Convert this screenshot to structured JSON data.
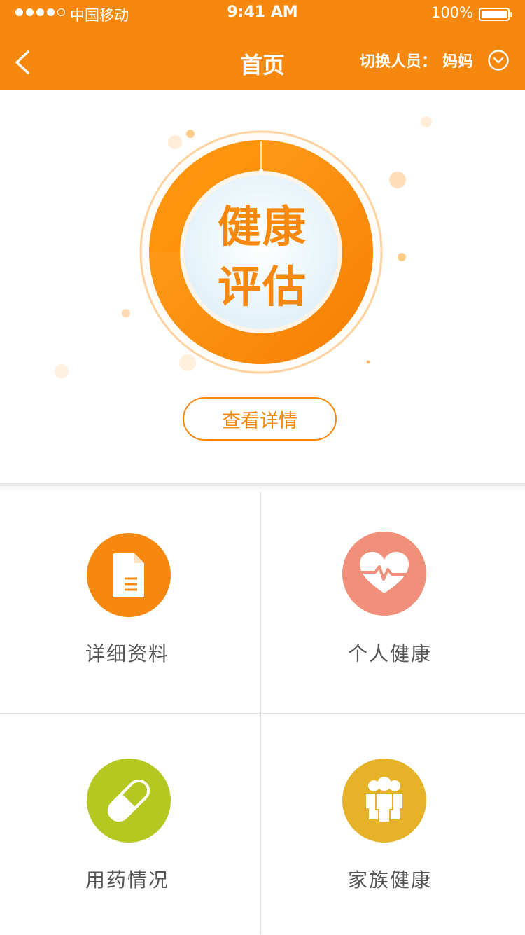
{
  "status_bar": {
    "carrier": "中国移动",
    "time": "9:41 AM",
    "battery": "100%"
  },
  "nav": {
    "title": "首页",
    "switch_label": "切换人员：",
    "switch_value": "妈妈"
  },
  "hero": {
    "line1": "健康",
    "line2": "评估",
    "details_button": "查看详情"
  },
  "grid": [
    {
      "label": "详细资料",
      "icon": "document-icon",
      "color": "#f7880f"
    },
    {
      "label": "个人健康",
      "icon": "heart-pulse-icon",
      "color": "#f0907a"
    },
    {
      "label": "用药情况",
      "icon": "pill-icon",
      "color": "#b5c821"
    },
    {
      "label": "家族健康",
      "icon": "family-icon",
      "color": "#e6b22a"
    }
  ],
  "colors": {
    "brand": "#f7880f",
    "ring_light": "#ffa21f",
    "ring_dark": "#f77f00"
  }
}
